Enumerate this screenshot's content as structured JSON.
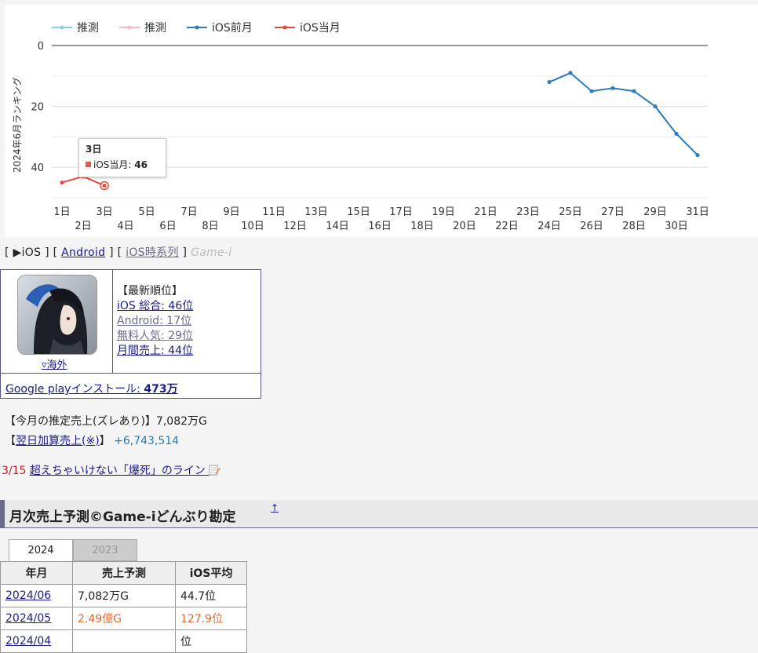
{
  "chart_data": {
    "type": "line",
    "ylabel": "2024年6月ランキング",
    "ylim": [
      0,
      50
    ],
    "y_inverted": true,
    "y_ticks": [
      0,
      20,
      40
    ],
    "x": [
      1,
      2,
      3,
      4,
      5,
      6,
      7,
      8,
      9,
      10,
      11,
      12,
      13,
      14,
      15,
      16,
      17,
      18,
      19,
      20,
      21,
      22,
      23,
      24,
      25,
      26,
      27,
      28,
      29,
      30,
      31
    ],
    "x_tick_labels": [
      "1日",
      "2日",
      "3日",
      "4日",
      "5日",
      "6日",
      "7日",
      "8日",
      "9日",
      "10日",
      "11日",
      "12日",
      "13日",
      "14日",
      "15日",
      "16日",
      "17日",
      "18日",
      "19日",
      "20日",
      "21日",
      "22日",
      "23日",
      "24日",
      "25日",
      "26日",
      "27日",
      "28日",
      "29日",
      "30日",
      "31日"
    ],
    "legend_position": "top-left",
    "series": [
      {
        "name": "推測",
        "color": "#87cfe8",
        "points": []
      },
      {
        "name": "推測",
        "color": "#f7b3c8",
        "points": []
      },
      {
        "name": "iOS前月",
        "color": "#2b7bb9",
        "points": [
          [
            24,
            12
          ],
          [
            25,
            9
          ],
          [
            26,
            15
          ],
          [
            27,
            14
          ],
          [
            28,
            15
          ],
          [
            29,
            20
          ],
          [
            30,
            29
          ],
          [
            31,
            36
          ]
        ]
      },
      {
        "name": "iOS当月",
        "color": "#e24a3b",
        "points": [
          [
            1,
            45
          ],
          [
            2,
            43
          ],
          [
            3,
            46
          ]
        ]
      }
    ],
    "tooltip": {
      "day": "3日",
      "series": "iOS当月",
      "value": "46"
    }
  },
  "nav": {
    "open": "[",
    "ios": "▶iOS",
    "sep1": "] [",
    "android": "Android",
    "sep2": "] [",
    "ios_timeseries": "iOS時系列",
    "close": "]",
    "brand": "Game-i"
  },
  "app": {
    "region_link": "▿海外",
    "latest_rank_heading": "【最新順位】",
    "ios_total": "iOS 総合: 46位",
    "android": "Android: 17位",
    "free": "無料人気: 29位",
    "monthly": "月間売上: 44位",
    "gp_label": "Google playインストール: ",
    "gp_value": "473万"
  },
  "sales": {
    "estimate_text": "【今月の推定売上(ズレあり)】7,082万G",
    "next_open": "【",
    "next_link": "翌日加算売上(※)",
    "next_close": "】",
    "next_value": "+6,743,514"
  },
  "news": {
    "date": "3/15",
    "title": "超えちゃいけない「爆死」のライン"
  },
  "section": {
    "title": "月次売上予測©Game-iどんぶり勘定",
    "up_mark": "↑"
  },
  "tabs": [
    "2024",
    "2023"
  ],
  "table": {
    "headers": [
      "年月",
      "売上予測",
      "iOS平均"
    ],
    "rows": [
      [
        "2024/06",
        "7,082万G",
        "44.7位"
      ],
      [
        "2024/05",
        "2.49億G",
        "127.9位"
      ],
      [
        "2024/04",
        "",
        "位"
      ]
    ]
  },
  "colors": {
    "nav_border": "#55558a",
    "highlight": "#e06a30",
    "link": "#1a1a8c"
  }
}
